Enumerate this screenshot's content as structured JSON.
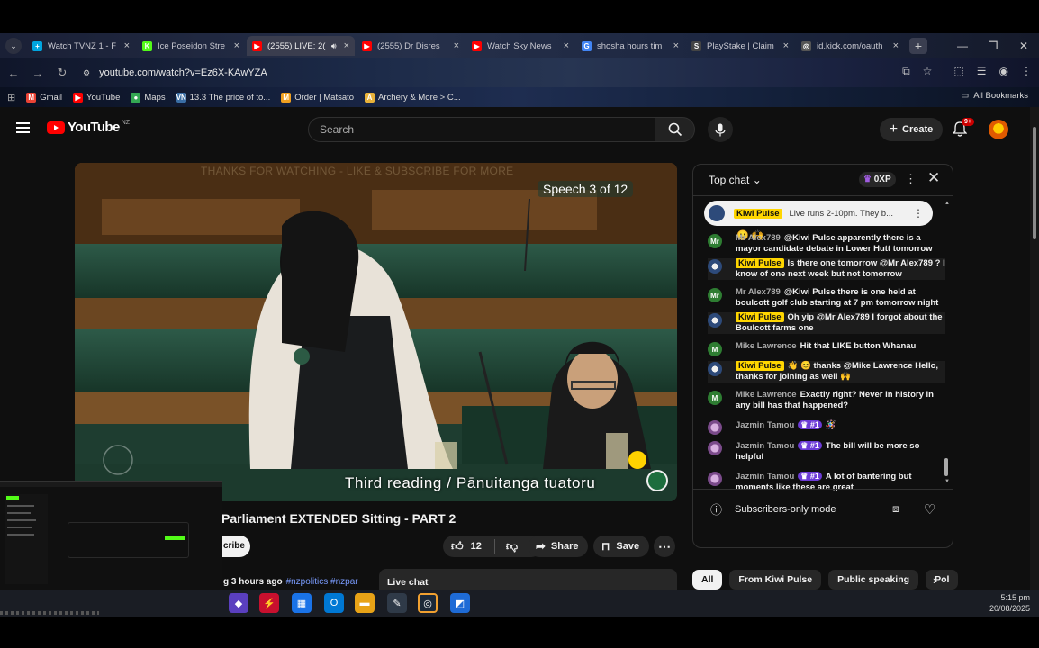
{
  "browser": {
    "tabs": [
      {
        "label": "Watch TVNZ 1 - F",
        "fav": "+",
        "fav_color": "#00a5e0"
      },
      {
        "label": "Ice Poseidon Stre",
        "fav": "K",
        "fav_color": "#53fc18"
      },
      {
        "label": "(2555) LIVE: 2(",
        "fav": "▶",
        "fav_color": "#ff0000",
        "active": true
      },
      {
        "label": "(2555) Dr Disres",
        "fav": "▶",
        "fav_color": "#ff0000"
      },
      {
        "label": "Watch Sky News",
        "fav": "▶",
        "fav_color": "#ff0000"
      },
      {
        "label": "shosha hours tim",
        "fav": "G",
        "fav_color": "#4285f4"
      },
      {
        "label": "PlayStake | Claim",
        "fav": "S",
        "fav_color": "#444444"
      },
      {
        "label": "id.kick.com/oauth",
        "fav": "◎",
        "fav_color": "#555555"
      }
    ],
    "url": "youtube.com/watch?v=Ez6X-KAwYZA",
    "bookmarks": [
      {
        "label": "Gmail",
        "icon": "gmail-icon",
        "color": "#ea4335",
        "glyph": "M"
      },
      {
        "label": "YouTube",
        "icon": "youtube-icon",
        "color": "#ff0000",
        "glyph": "▶"
      },
      {
        "label": "Maps",
        "icon": "maps-icon",
        "color": "#34a853",
        "glyph": "●"
      },
      {
        "label": "13.3 The price of to...",
        "icon": "page-icon",
        "color": "#3a6ea5",
        "glyph": "VN"
      },
      {
        "label": "Order | Matsato",
        "icon": "shop-icon",
        "color": "#f0a020",
        "glyph": "M"
      },
      {
        "label": "Archery & More > C...",
        "icon": "archery-icon",
        "color": "#e8b23a",
        "glyph": "A"
      }
    ],
    "all_bookmarks": "All Bookmarks"
  },
  "youtube": {
    "region": "NZ",
    "search_placeholder": "Search",
    "create_label": "Create",
    "notif_badge": "9+",
    "video": {
      "overlay_text": "THANKS FOR WATCHING - LIKE & SUBSCRIBE FOR MORE",
      "speech_counter": "Speech 3 of 12",
      "caption": "Third  reading  /  Pānuitanga  tuatoru",
      "title": "Parliament EXTENDED Sitting - PART 2",
      "subscribe_label": "cribe",
      "likes": "12",
      "share_label": "Share",
      "save_label": "Save",
      "meta": "g 3 hours ago",
      "tags": "#nzpolitics #nzpar",
      "live_chat_label": "Live chat"
    },
    "chat": {
      "title": "Top chat",
      "xp": "0XP",
      "pinned": {
        "author": "Kiwi Pulse",
        "text": "Live runs 2-10pm. They b..."
      },
      "messages": [
        {
          "author": "Mr Alex789",
          "text": "@Kiwi Pulse apparently there is a mayor candidate debate in Lower Hutt tomorrow",
          "type": "user",
          "avatar": "Mr"
        },
        {
          "author": "Kiwi Pulse",
          "text": "Is there one tomorrow @Mr Alex789 ? I know of one next week but not tomorrow",
          "type": "owner"
        },
        {
          "author": "Mr Alex789",
          "text": "@Kiwi Pulse there is one held at boulcott golf club starting at 7 pm tomorrow night",
          "type": "user",
          "avatar": "Mr"
        },
        {
          "author": "Kiwi Pulse",
          "text": "Oh yip @Mr Alex789 I forgot about the Boulcott farms one",
          "type": "owner"
        },
        {
          "author": "Mike Lawrence",
          "text": "Hit that LIKE button Whanau",
          "type": "user",
          "avatar": "M"
        },
        {
          "author": "Kiwi Pulse",
          "text": "👋 😊 thanks @Mike Lawrence Hello, thanks for joining as well 🙌",
          "type": "owner"
        },
        {
          "author": "Mike Lawrence",
          "text": "Exactly right? Never in history in any bill has that happened?",
          "type": "user",
          "avatar": "M"
        },
        {
          "author": "Jazmin Tamou",
          "text": "",
          "type": "member",
          "badge": "#1"
        },
        {
          "author": "Jazmin Tamou",
          "text": "The bill will be more so helpful",
          "type": "member",
          "badge": "#1"
        },
        {
          "author": "Jazmin Tamou",
          "text": "A lot of bantering but moments like these are great",
          "type": "member",
          "badge": "#1"
        }
      ],
      "subscribers_only": "Subscribers-only mode"
    },
    "chips": [
      {
        "label": "All",
        "active": true
      },
      {
        "label": "From Kiwi Pulse"
      },
      {
        "label": "Public speaking"
      },
      {
        "label": "Pol"
      }
    ]
  },
  "taskbar": {
    "time": "5:15 pm",
    "date": "20/08/2025"
  },
  "colors": {
    "youtube_red": "#ff0000",
    "owner_badge": "#ffd600",
    "member_badge": "#6c3bd6",
    "link_blue": "#7a9cff"
  }
}
